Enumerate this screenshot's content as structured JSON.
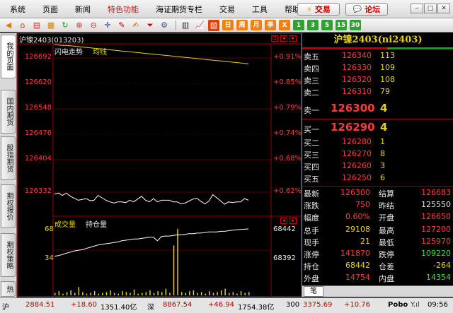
{
  "menu": {
    "items": [
      "系统",
      "页面",
      "新闻",
      "特色功能",
      "海证期货专栏",
      "交易",
      "工具",
      "帮助"
    ],
    "trade_button": "交易",
    "forum_button": "论坛"
  },
  "toolbar": {
    "periods": [
      "日",
      "周",
      "月",
      "季",
      "X",
      "1",
      "3",
      "5",
      "15",
      "30"
    ]
  },
  "left_tabs": [
    "我的页面",
    "国内期货",
    "股指期货",
    "期权报价",
    "期权策略",
    "热"
  ],
  "chart": {
    "title": "沪镍2403(013203)",
    "flash_label": "闪电走势",
    "avg_label": "均线",
    "price_labels": [
      "126692",
      "126620",
      "126548",
      "126476",
      "126404",
      "126332"
    ],
    "pct_labels": [
      "+0.91%",
      "+0.85%",
      "+0.79%",
      "+0.74%",
      "+0.68%",
      "+0.62%"
    ],
    "volume_label": "成交量",
    "oi_label": "持仓量",
    "vol_scale": [
      "68",
      "34"
    ],
    "oi_scale": [
      "68442",
      "68392"
    ]
  },
  "chart_data": {
    "type": "line",
    "price_ylim": [
      126260,
      126692
    ],
    "price_series": [
      126315,
      126318,
      126312,
      126318,
      126310,
      126305,
      126300,
      126302,
      126304,
      126299,
      126300,
      126312,
      126306,
      126300,
      126296,
      126293,
      126296,
      126296,
      126294,
      126300,
      126296,
      126303,
      126310,
      126300,
      126296,
      126304,
      126296,
      126300,
      126300,
      126300,
      126296,
      126296,
      126291,
      126293,
      126298,
      126303,
      126305,
      126297,
      126291,
      126298,
      126314,
      126306,
      126298,
      126290,
      126296,
      126294,
      126296,
      126296,
      126304,
      126300
    ],
    "avg_series": [
      126690,
      126689,
      126688,
      126688,
      126687,
      126686,
      126685,
      126684,
      126683,
      126682,
      126681,
      126680,
      126679,
      126678,
      126677,
      126676,
      126675,
      126674,
      126673,
      126672,
      126671,
      126670,
      126669,
      126668,
      126667,
      126666,
      126665,
      126664,
      126663,
      126662,
      126661,
      126660,
      126659,
      126658,
      126657,
      126656,
      126655,
      126654,
      126653,
      126652,
      126651,
      126650,
      126649,
      126648,
      126647,
      126646,
      126645,
      126644,
      126643,
      126642
    ],
    "oi_series": [
      0.08,
      0.1,
      0.14,
      0.18,
      0.22,
      0.26,
      0.28,
      0.3,
      0.34,
      0.38,
      0.42,
      0.46,
      0.48,
      0.5,
      0.52,
      0.54,
      0.56,
      0.6,
      0.62,
      0.64,
      0.66,
      0.66,
      0.68,
      0.7,
      0.72,
      0.72,
      0.6,
      0.74,
      0.76,
      0.76,
      0.78,
      0.8,
      0.8,
      0.82,
      0.84,
      0.84,
      0.86,
      0.86,
      0.88,
      0.9,
      0.9,
      0.9,
      0.92,
      0.92,
      0.94,
      0.96,
      0.97,
      0.98,
      0.99,
      1.0
    ],
    "volume_series": [
      3,
      5,
      2,
      4,
      6,
      3,
      10,
      4,
      2,
      3,
      5,
      2,
      3,
      4,
      6,
      3,
      2,
      5,
      4,
      3,
      7,
      2,
      3,
      4,
      6,
      3,
      5,
      4,
      8,
      3,
      60,
      80,
      4,
      3,
      5,
      6,
      3,
      4,
      2,
      5,
      3,
      4,
      6,
      8,
      3,
      4,
      2,
      5,
      3,
      4
    ],
    "ylabel": "",
    "xlabel": ""
  },
  "quote": {
    "name": "沪镍2403(ni2403)",
    "sells": [
      {
        "label": "卖五",
        "price": "126340",
        "vol": "113"
      },
      {
        "label": "卖四",
        "price": "126330",
        "vol": "109"
      },
      {
        "label": "卖三",
        "price": "126320",
        "vol": "108"
      },
      {
        "label": "卖二",
        "price": "126310",
        "vol": "79"
      },
      {
        "label": "卖一",
        "price": "126300",
        "vol": "4"
      }
    ],
    "buys": [
      {
        "label": "买一",
        "price": "126290",
        "vol": "4"
      },
      {
        "label": "买二",
        "price": "126280",
        "vol": "1"
      },
      {
        "label": "买三",
        "price": "126270",
        "vol": "8"
      },
      {
        "label": "买四",
        "price": "126260",
        "vol": "3"
      },
      {
        "label": "买五",
        "price": "126250",
        "vol": "6"
      }
    ],
    "stats": [
      {
        "l1": "最新",
        "v1": "126300",
        "c1": "red",
        "l2": "结算",
        "v2": "126683",
        "c2": "red"
      },
      {
        "l1": "涨跌",
        "v1": "750",
        "c1": "red",
        "l2": "昨结",
        "v2": "125550",
        "c2": "white"
      },
      {
        "l1": "幅度",
        "v1": "0.60%",
        "c1": "red",
        "l2": "开盘",
        "v2": "126650",
        "c2": "red"
      },
      {
        "l1": "总手",
        "v1": "29108",
        "c1": "yel",
        "l2": "最高",
        "v2": "127200",
        "c2": "red"
      },
      {
        "l1": "现手",
        "v1": "21",
        "c1": "yel",
        "l2": "最低",
        "v2": "125970",
        "c2": "red"
      },
      {
        "l1": "涨停",
        "v1": "141870",
        "c1": "red",
        "l2": "跌停",
        "v2": "109220",
        "c2": "grn"
      },
      {
        "l1": "持仓",
        "v1": "68442",
        "c1": "yel",
        "l2": "仓差",
        "v2": "-264",
        "c2": "yel"
      },
      {
        "l1": "外盘",
        "v1": "14754",
        "c1": "red",
        "l2": "内盘",
        "v2": "14354",
        "c2": "grn"
      }
    ],
    "tab": "笔"
  },
  "status": {
    "sh_label": "沪",
    "sh_index": "2884.51",
    "sh_change": "+18.60",
    "sh_amount": "1351.40亿",
    "sz_label": "深",
    "sz_index": "8867.54",
    "sz_change": "+46.94",
    "sz_amount": "1754.38亿",
    "cyb_label": "300",
    "cyb_index": "3375.69",
    "cyb_change": "+10.76",
    "brand": "Pobo",
    "time": "09:56"
  }
}
